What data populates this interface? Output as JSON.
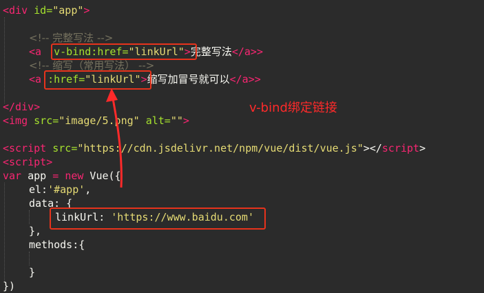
{
  "code": {
    "l1": {
      "open": "<div",
      "attr": " id=",
      "val": "\"app\"",
      "close": ">"
    },
    "l3": {
      "text": "<!-- 完整写法 -->"
    },
    "l4": {
      "open": "<a ",
      "attr": " v-bind:href=",
      "val": "\"linkUrl\"",
      "close": ">",
      "text": "完整写法",
      "end": "</a>"
    },
    "l5": {
      "text": "<!-- 缩写（常用写法） -->"
    },
    "l6": {
      "open": "<a",
      "attr": " :href=",
      "val": "\"linkUrl\"",
      "close": ">",
      "text": "缩写加冒号就可以",
      "end": "</a>"
    },
    "l8": {
      "text": "</div>"
    },
    "l9": {
      "open": "<img",
      "attr1": " src=",
      "val1": "\"image/5.png\"",
      "attr2": " alt=",
      "val2": "\"\"",
      "close": ">"
    },
    "l11": {
      "open": "<script",
      "attr": " src=",
      "val": "\"https://cdn.jsdelivr.net/npm/vue/dist/vue.js\"",
      "close": "></",
      "closetag": "script",
      "end": ">"
    },
    "l12": {
      "open": "<script",
      "close": ">"
    },
    "l13": {
      "kw": "var",
      "a": " app ",
      "eq": "=",
      "b": " ",
      "new": "new",
      "c": " Vue({"
    },
    "l14": {
      "a": "el:",
      "val": "'#app'",
      "b": ","
    },
    "l15": {
      "a": "data: {"
    },
    "l16": {
      "a": "linkUrl: ",
      "val": "'https://www.baidu.com'"
    },
    "l17": {
      "a": "},"
    },
    "l18": {
      "a": "methods:{"
    },
    "l20": {
      "a": "}"
    },
    "l21": {
      "a": "})"
    }
  },
  "annotation": {
    "label": "v-bind绑定链接",
    "color": "#ff2a2a"
  }
}
